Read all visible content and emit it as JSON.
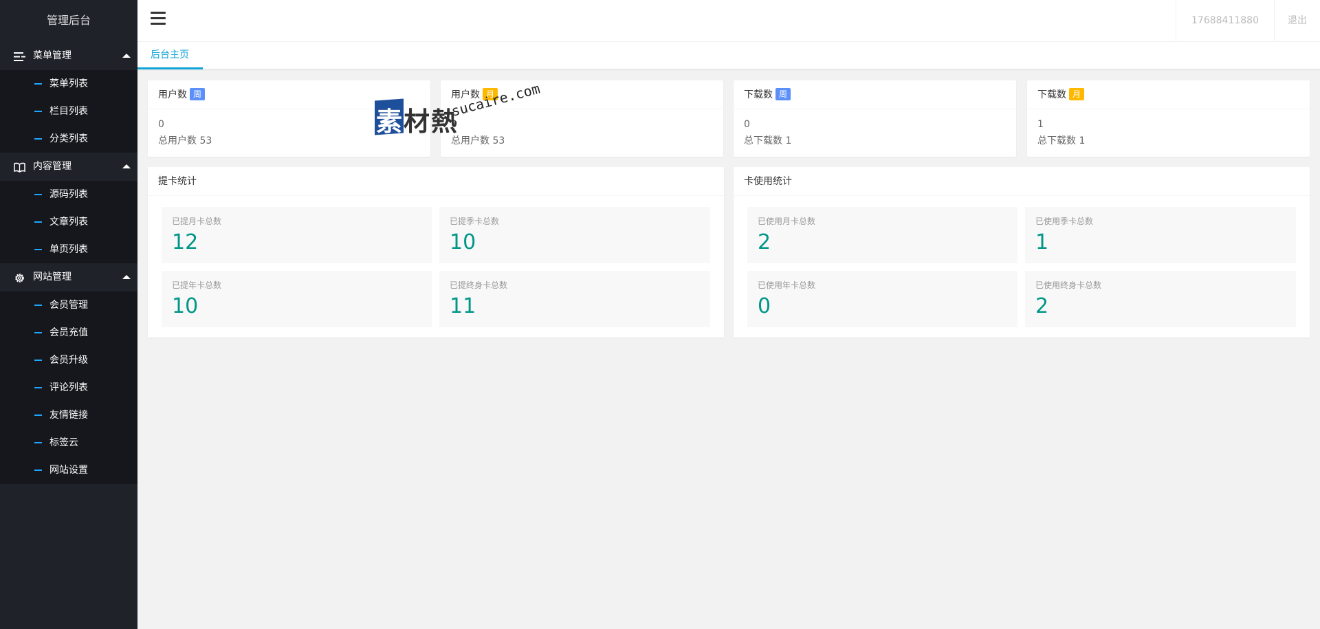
{
  "sidebar": {
    "logo": "管理后台",
    "groups": [
      {
        "label": "菜单管理",
        "icon": "list-icon",
        "items": [
          "菜单列表",
          "栏目列表",
          "分类列表"
        ]
      },
      {
        "label": "内容管理",
        "icon": "book-icon",
        "items": [
          "源码列表",
          "文章列表",
          "单页列表"
        ]
      },
      {
        "label": "网站管理",
        "icon": "gear-icon",
        "items": [
          "会员管理",
          "会员充值",
          "会员升级",
          "评论列表",
          "友情链接",
          "标签云",
          "网站设置"
        ]
      }
    ]
  },
  "header": {
    "phone": "17688411880",
    "logout": "退出"
  },
  "tabs": {
    "home": "后台主页"
  },
  "stats": [
    {
      "title": "用户数",
      "badge": "周",
      "badge_color": "#5b8ff9",
      "value": "0",
      "total": "总用户数 53"
    },
    {
      "title": "用户数",
      "badge": "月",
      "badge_color": "#ffb800",
      "value": "0",
      "total": "总用户数 53"
    },
    {
      "title": "下载数",
      "badge": "周",
      "badge_color": "#5b8ff9",
      "value": "0",
      "total": "总下载数 1"
    },
    {
      "title": "下载数",
      "badge": "月",
      "badge_color": "#ffb800",
      "value": "1",
      "total": "总下载数 1"
    }
  ],
  "panels": [
    {
      "title": "提卡统计",
      "tiles": [
        {
          "label": "已提月卡总数",
          "value": "12"
        },
        {
          "label": "已提季卡总数",
          "value": "10"
        },
        {
          "label": "已提年卡总数",
          "value": "10"
        },
        {
          "label": "已提终身卡总数",
          "value": "11"
        }
      ]
    },
    {
      "title": "卡使用统计",
      "tiles": [
        {
          "label": "已使用月卡总数",
          "value": "2"
        },
        {
          "label": "已使用季卡总数",
          "value": "1"
        },
        {
          "label": "已使用年卡总数",
          "value": "0"
        },
        {
          "label": "已使用终身卡总数",
          "value": "2"
        }
      ]
    }
  ],
  "watermark": {
    "chars": [
      "素",
      "材",
      "熱"
    ],
    "domain": "sucaire.com"
  },
  "colors": {
    "accent": "#0fa3d7",
    "value": "#009688",
    "sidebar": "#20222a",
    "sidebar_sub": "#15171d"
  }
}
